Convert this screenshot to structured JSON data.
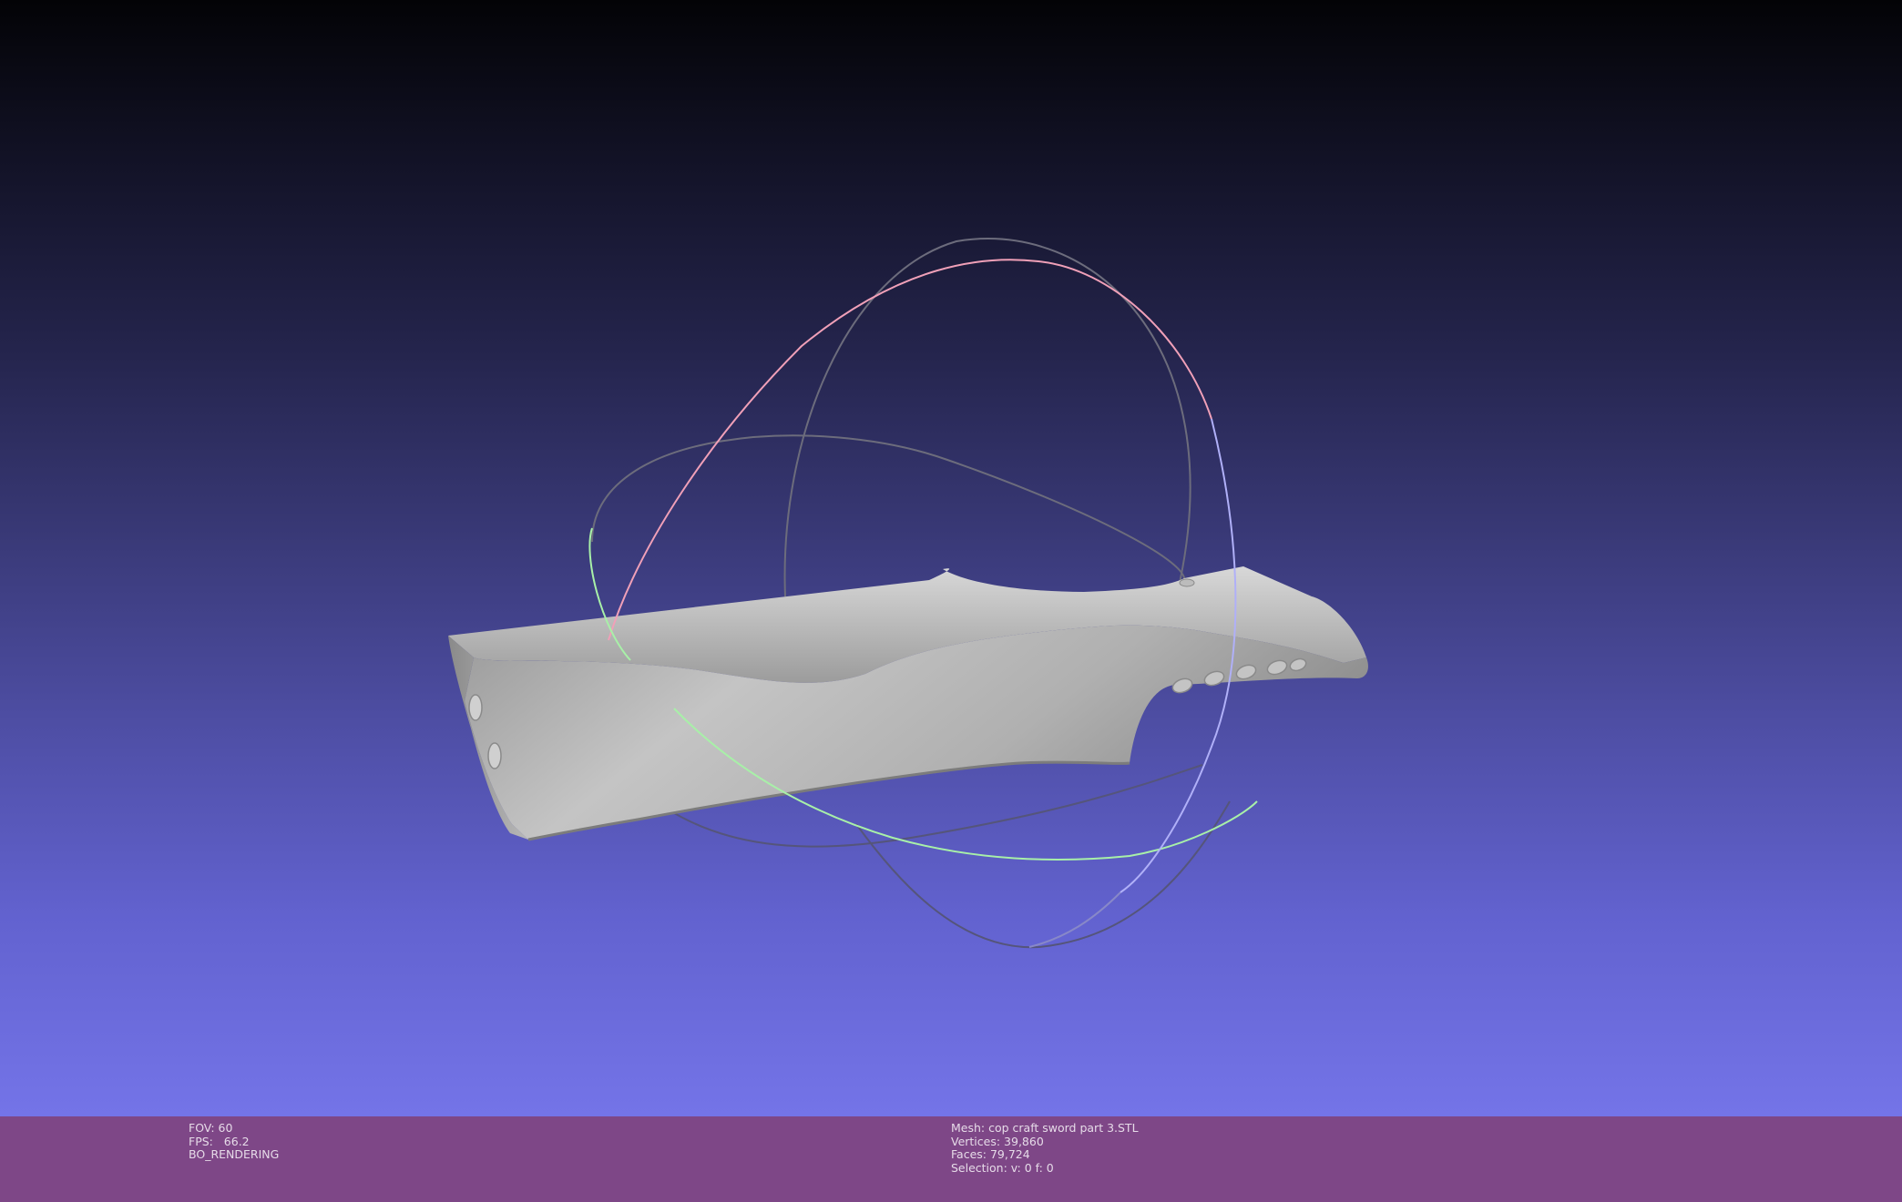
{
  "render_info": {
    "fov": "FOV: 60",
    "fps": "FPS:   66.2",
    "mode": "BO_RENDERING"
  },
  "mesh_info": {
    "mesh": "Mesh: cop craft sword part 3.STL",
    "vertices": "Vertices: 39,860",
    "faces": "Faces: 79,724",
    "selection": "Selection: v: 0 f: 0"
  },
  "colors": {
    "background_top": "#030306",
    "background_bottom": "#7474e8",
    "status_bar": "#7e4787",
    "trackball_x_axis": "#f0a0b8",
    "trackball_y_axis": "#a8f0a8",
    "trackball_z_axis": "#b0b0f8",
    "mesh_surface": "#a8a8a8"
  },
  "icons": {
    "trackball": "trackball-gizmo",
    "mesh": "sword-handle-mesh"
  }
}
